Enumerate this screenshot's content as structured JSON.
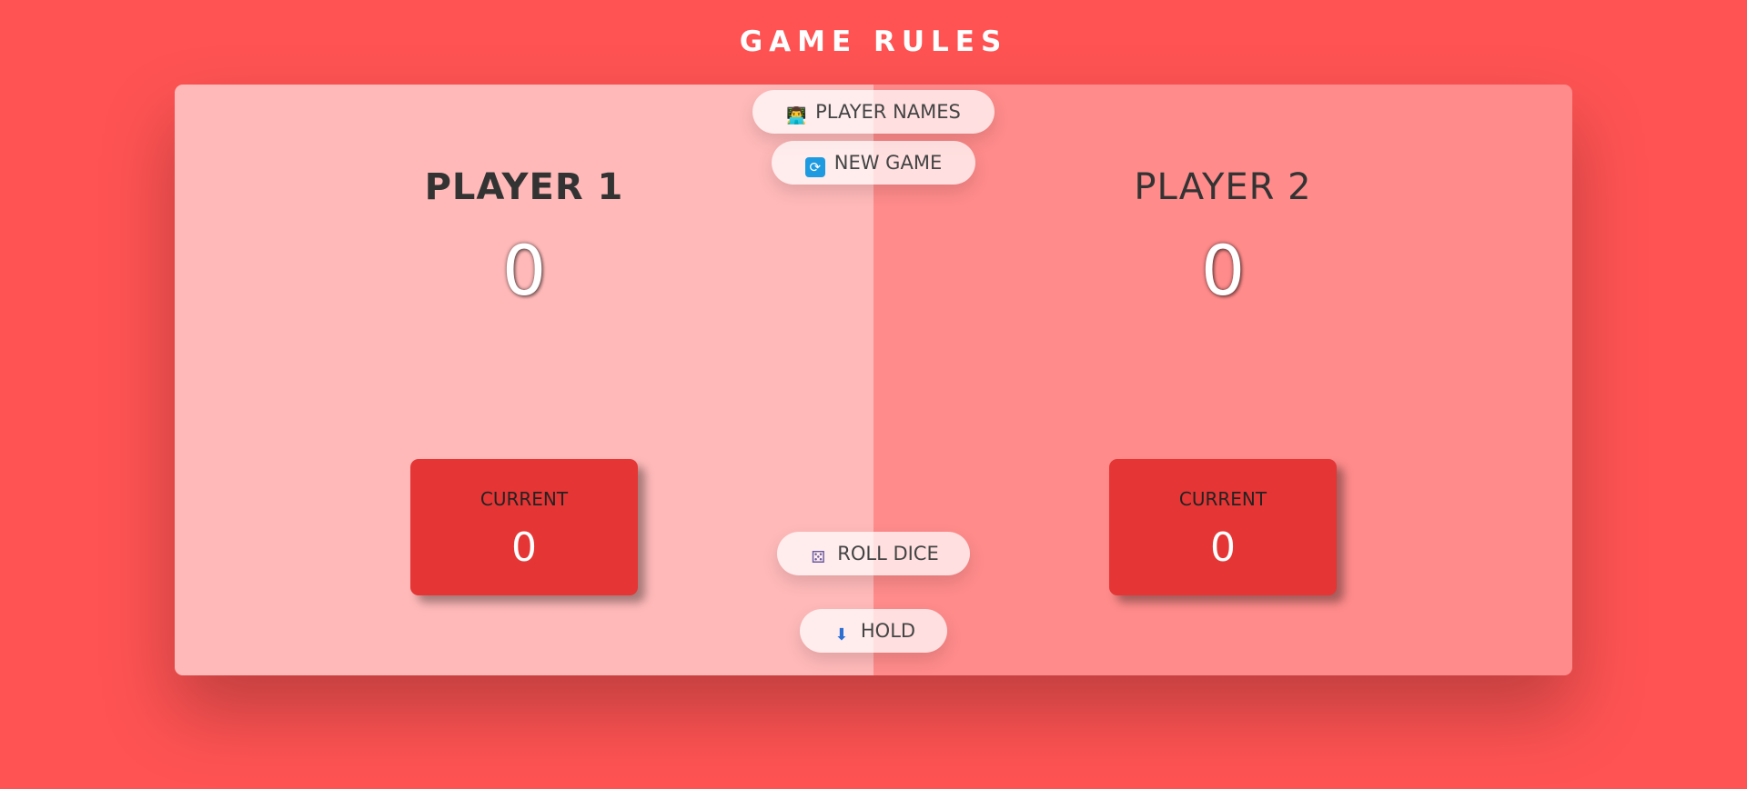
{
  "header": {
    "rules_label": "GAME RULES"
  },
  "players": [
    {
      "name": "PLAYER 1",
      "total_score": "0",
      "current_label": "CURRENT",
      "current_score": "0"
    },
    {
      "name": "PLAYER 2",
      "total_score": "0",
      "current_label": "CURRENT",
      "current_score": "0"
    }
  ],
  "controls": {
    "player_names": {
      "label": "PLAYER NAMES",
      "icon": "person-at-computer-icon",
      "glyph": "👨‍💻"
    },
    "new_game": {
      "label": "NEW GAME",
      "icon": "refresh-icon",
      "glyph": "⟳"
    },
    "roll_dice": {
      "label": "ROLL DICE",
      "icon": "dice-icon",
      "glyph": "⚄"
    },
    "hold": {
      "label": "HOLD",
      "icon": "inbox-tray-icon",
      "glyph": "⬇"
    }
  },
  "colors": {
    "background": "#ff5353",
    "player1_panel": "#ffb9b9",
    "player2_panel": "#ff8b8b",
    "current_box": "#e53535"
  }
}
